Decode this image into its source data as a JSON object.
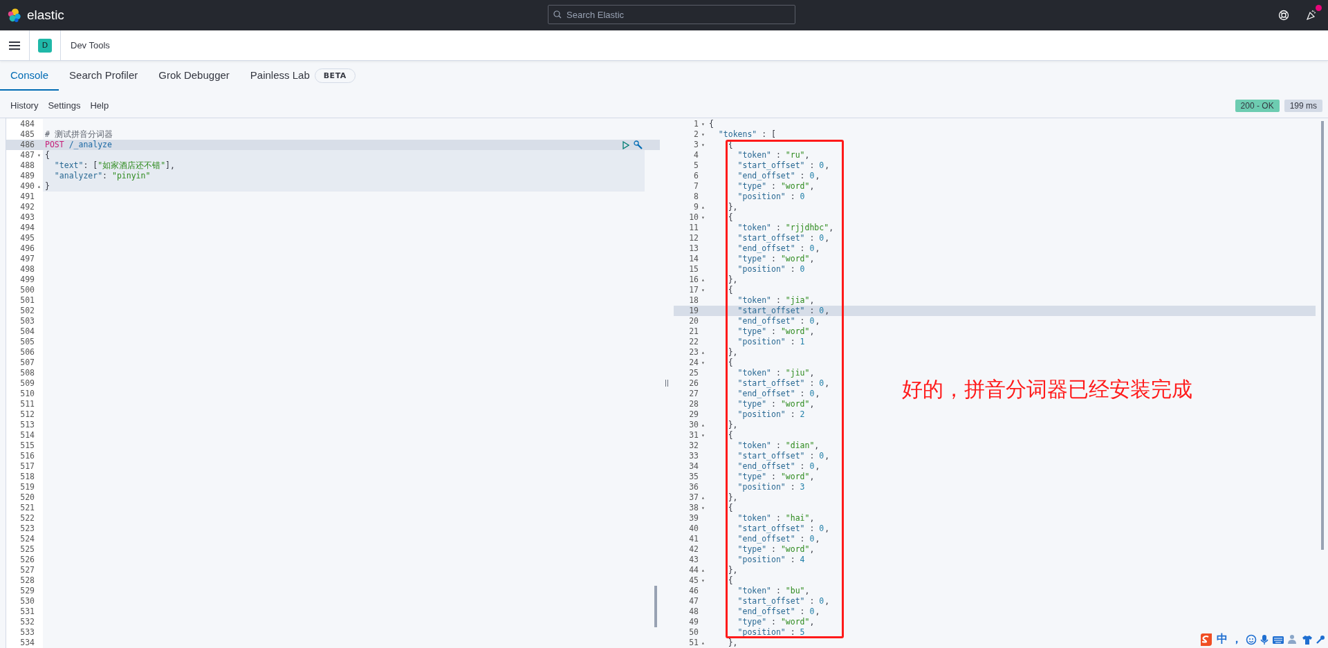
{
  "header": {
    "brand": "elastic",
    "search": {
      "placeholder": "Search Elastic"
    },
    "news_unread": true
  },
  "breadcrumb": {
    "space_initial": "D",
    "title": "Dev Tools"
  },
  "tabs": [
    {
      "label": "Console",
      "selected": true
    },
    {
      "label": "Search Profiler",
      "selected": false
    },
    {
      "label": "Grok Debugger",
      "selected": false
    },
    {
      "label": "Painless Lab",
      "selected": false,
      "badge": "BETA"
    }
  ],
  "menu": [
    "History",
    "Settings",
    "Help"
  ],
  "status": {
    "code": "200 - OK",
    "time": "199 ms"
  },
  "request_lines": [
    {
      "n": "484",
      "kind": "blank",
      "active": false,
      "in_request": false
    },
    {
      "n": "485",
      "kind": "comment",
      "text": "# 测试拼音分词器",
      "active": false,
      "in_request": false
    },
    {
      "n": "486",
      "kind": "request",
      "method": "POST",
      "path": "/_analyze",
      "active": true,
      "in_request": true
    },
    {
      "n": "487",
      "kind": "json",
      "text": "{",
      "fold": "▾",
      "active": false,
      "in_request": true
    },
    {
      "n": "488",
      "kind": "json",
      "text": "  \"text\": [\"如家酒店还不错\"],",
      "active": false,
      "in_request": true
    },
    {
      "n": "489",
      "kind": "json",
      "text": "  \"analyzer\": \"pinyin\"",
      "active": false,
      "in_request": true
    },
    {
      "n": "490",
      "kind": "json",
      "text": "}",
      "fold": "▴",
      "active": false,
      "in_request": true
    },
    {
      "n": "491",
      "kind": "blank",
      "active": false,
      "in_request": false
    },
    {
      "n": "492",
      "kind": "blank",
      "active": false,
      "in_request": false
    },
    {
      "n": "493",
      "kind": "blank",
      "active": false,
      "in_request": false
    },
    {
      "n": "494",
      "kind": "blank",
      "active": false,
      "in_request": false
    },
    {
      "n": "495",
      "kind": "blank",
      "active": false,
      "in_request": false
    },
    {
      "n": "496",
      "kind": "blank",
      "active": false,
      "in_request": false
    },
    {
      "n": "497",
      "kind": "blank",
      "active": false,
      "in_request": false
    },
    {
      "n": "498",
      "kind": "blank",
      "active": false,
      "in_request": false
    },
    {
      "n": "499",
      "kind": "blank",
      "active": false,
      "in_request": false
    },
    {
      "n": "500",
      "kind": "blank",
      "active": false,
      "in_request": false
    },
    {
      "n": "501",
      "kind": "blank",
      "active": false,
      "in_request": false
    },
    {
      "n": "502",
      "kind": "blank",
      "active": false,
      "in_request": false
    },
    {
      "n": "503",
      "kind": "blank",
      "active": false,
      "in_request": false
    },
    {
      "n": "504",
      "kind": "blank",
      "active": false,
      "in_request": false
    },
    {
      "n": "505",
      "kind": "blank",
      "active": false,
      "in_request": false
    },
    {
      "n": "506",
      "kind": "blank",
      "active": false,
      "in_request": false
    },
    {
      "n": "507",
      "kind": "blank",
      "active": false,
      "in_request": false
    },
    {
      "n": "508",
      "kind": "blank",
      "active": false,
      "in_request": false
    },
    {
      "n": "509",
      "kind": "blank",
      "active": false,
      "in_request": false
    },
    {
      "n": "510",
      "kind": "blank",
      "active": false,
      "in_request": false
    },
    {
      "n": "511",
      "kind": "blank",
      "active": false,
      "in_request": false
    },
    {
      "n": "512",
      "kind": "blank",
      "active": false,
      "in_request": false
    },
    {
      "n": "513",
      "kind": "blank",
      "active": false,
      "in_request": false
    },
    {
      "n": "514",
      "kind": "blank",
      "active": false,
      "in_request": false
    },
    {
      "n": "515",
      "kind": "blank",
      "active": false,
      "in_request": false
    },
    {
      "n": "516",
      "kind": "blank",
      "active": false,
      "in_request": false
    },
    {
      "n": "517",
      "kind": "blank",
      "active": false,
      "in_request": false
    },
    {
      "n": "518",
      "kind": "blank",
      "active": false,
      "in_request": false
    },
    {
      "n": "519",
      "kind": "blank",
      "active": false,
      "in_request": false
    },
    {
      "n": "520",
      "kind": "blank",
      "active": false,
      "in_request": false
    },
    {
      "n": "521",
      "kind": "blank",
      "active": false,
      "in_request": false
    },
    {
      "n": "522",
      "kind": "blank",
      "active": false,
      "in_request": false
    },
    {
      "n": "523",
      "kind": "blank",
      "active": false,
      "in_request": false
    },
    {
      "n": "524",
      "kind": "blank",
      "active": false,
      "in_request": false
    },
    {
      "n": "525",
      "kind": "blank",
      "active": false,
      "in_request": false
    },
    {
      "n": "526",
      "kind": "blank",
      "active": false,
      "in_request": false
    },
    {
      "n": "527",
      "kind": "blank",
      "active": false,
      "in_request": false
    },
    {
      "n": "528",
      "kind": "blank",
      "active": false,
      "in_request": false
    },
    {
      "n": "529",
      "kind": "blank",
      "active": false,
      "in_request": false
    },
    {
      "n": "530",
      "kind": "blank",
      "active": false,
      "in_request": false
    },
    {
      "n": "531",
      "kind": "blank",
      "active": false,
      "in_request": false
    },
    {
      "n": "532",
      "kind": "blank",
      "active": false,
      "in_request": false
    },
    {
      "n": "533",
      "kind": "blank",
      "active": false,
      "in_request": false
    },
    {
      "n": "534",
      "kind": "blank",
      "active": false,
      "in_request": false
    }
  ],
  "response_lines": [
    {
      "n": "1",
      "text": "{",
      "fold": "▾",
      "active": false
    },
    {
      "n": "2",
      "text": "  \"tokens\" : [",
      "fold": "▾",
      "active": false
    },
    {
      "n": "3",
      "text": "    {",
      "fold": "▾",
      "active": false
    },
    {
      "n": "4",
      "text": "      \"token\" : \"ru\",",
      "active": false
    },
    {
      "n": "5",
      "text": "      \"start_offset\" : 0,",
      "active": false
    },
    {
      "n": "6",
      "text": "      \"end_offset\" : 0,",
      "active": false
    },
    {
      "n": "7",
      "text": "      \"type\" : \"word\",",
      "active": false
    },
    {
      "n": "8",
      "text": "      \"position\" : 0",
      "active": false
    },
    {
      "n": "9",
      "text": "    },",
      "fold": "▴",
      "active": false
    },
    {
      "n": "10",
      "text": "    {",
      "fold": "▾",
      "active": false
    },
    {
      "n": "11",
      "text": "      \"token\" : \"rjjdhbc\",",
      "active": false
    },
    {
      "n": "12",
      "text": "      \"start_offset\" : 0,",
      "active": false
    },
    {
      "n": "13",
      "text": "      \"end_offset\" : 0,",
      "active": false
    },
    {
      "n": "14",
      "text": "      \"type\" : \"word\",",
      "active": false
    },
    {
      "n": "15",
      "text": "      \"position\" : 0",
      "active": false
    },
    {
      "n": "16",
      "text": "    },",
      "fold": "▴",
      "active": false
    },
    {
      "n": "17",
      "text": "    {",
      "fold": "▾",
      "active": false
    },
    {
      "n": "18",
      "text": "      \"token\" : \"jia\",",
      "active": false
    },
    {
      "n": "19",
      "text": "      \"start_offset\" : 0,",
      "active": true
    },
    {
      "n": "20",
      "text": "      \"end_offset\" : 0,",
      "active": false
    },
    {
      "n": "21",
      "text": "      \"type\" : \"word\",",
      "active": false
    },
    {
      "n": "22",
      "text": "      \"position\" : 1",
      "active": false
    },
    {
      "n": "23",
      "text": "    },",
      "fold": "▴",
      "active": false
    },
    {
      "n": "24",
      "text": "    {",
      "fold": "▾",
      "active": false
    },
    {
      "n": "25",
      "text": "      \"token\" : \"jiu\",",
      "active": false
    },
    {
      "n": "26",
      "text": "      \"start_offset\" : 0,",
      "active": false
    },
    {
      "n": "27",
      "text": "      \"end_offset\" : 0,",
      "active": false
    },
    {
      "n": "28",
      "text": "      \"type\" : \"word\",",
      "active": false
    },
    {
      "n": "29",
      "text": "      \"position\" : 2",
      "active": false
    },
    {
      "n": "30",
      "text": "    },",
      "fold": "▴",
      "active": false
    },
    {
      "n": "31",
      "text": "    {",
      "fold": "▾",
      "active": false
    },
    {
      "n": "32",
      "text": "      \"token\" : \"dian\",",
      "active": false
    },
    {
      "n": "33",
      "text": "      \"start_offset\" : 0,",
      "active": false
    },
    {
      "n": "34",
      "text": "      \"end_offset\" : 0,",
      "active": false
    },
    {
      "n": "35",
      "text": "      \"type\" : \"word\",",
      "active": false
    },
    {
      "n": "36",
      "text": "      \"position\" : 3",
      "active": false
    },
    {
      "n": "37",
      "text": "    },",
      "fold": "▴",
      "active": false
    },
    {
      "n": "38",
      "text": "    {",
      "fold": "▾",
      "active": false
    },
    {
      "n": "39",
      "text": "      \"token\" : \"hai\",",
      "active": false
    },
    {
      "n": "40",
      "text": "      \"start_offset\" : 0,",
      "active": false
    },
    {
      "n": "41",
      "text": "      \"end_offset\" : 0,",
      "active": false
    },
    {
      "n": "42",
      "text": "      \"type\" : \"word\",",
      "active": false
    },
    {
      "n": "43",
      "text": "      \"position\" : 4",
      "active": false
    },
    {
      "n": "44",
      "text": "    },",
      "fold": "▴",
      "active": false
    },
    {
      "n": "45",
      "text": "    {",
      "fold": "▾",
      "active": false
    },
    {
      "n": "46",
      "text": "      \"token\" : \"bu\",",
      "active": false
    },
    {
      "n": "47",
      "text": "      \"start_offset\" : 0,",
      "active": false
    },
    {
      "n": "48",
      "text": "      \"end_offset\" : 0,",
      "active": false
    },
    {
      "n": "49",
      "text": "      \"type\" : \"word\",",
      "active": false
    },
    {
      "n": "50",
      "text": "      \"position\" : 5",
      "active": false
    },
    {
      "n": "51",
      "text": "    },",
      "fold": "▴",
      "active": false
    }
  ],
  "annotation": "好的，拼音分词器已经安装完成",
  "ime_toolbar": {
    "mode": "中",
    "punctuation": "，"
  }
}
